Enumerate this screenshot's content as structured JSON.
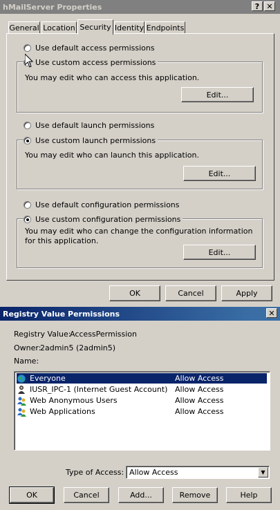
{
  "props_window": {
    "title": "hMailServer Properties",
    "help_glyph": "?",
    "close_glyph": "✕",
    "tabs": [
      "General",
      "Location",
      "Security",
      "Identity",
      "Endpoints"
    ],
    "selected_tab": "Security",
    "access": {
      "default_label": "Use default access permissions",
      "custom_label": "Use custom access permissions",
      "desc": "You may edit who can access this application.",
      "edit_label": "Edit..."
    },
    "launch": {
      "default_label": "Use default launch permissions",
      "custom_label": "Use custom launch permissions",
      "desc": "You may edit who can launch this application.",
      "edit_label": "Edit..."
    },
    "config": {
      "default_label": "Use default configuration permissions",
      "custom_label": "Use custom configuration permissions",
      "desc": "You may edit who can change the configuration information for this application.",
      "edit_label": "Edit..."
    },
    "buttons": {
      "ok": "OK",
      "cancel": "Cancel",
      "apply": "Apply"
    }
  },
  "reg_window": {
    "title": "Registry Value Permissions",
    "close_glyph": "✕",
    "registry_value_label": "Registry Value:",
    "registry_value": "AccessPermission",
    "owner_label": "Owner:",
    "owner": "2admin5 (2admin5)",
    "name_label": "Name:",
    "entries": [
      {
        "name": "Everyone",
        "access": "Allow Access",
        "icon": "globe-icon",
        "selected": true
      },
      {
        "name": "IUSR_IPC-1 (Internet Guest Account)",
        "access": "Allow Access",
        "icon": "user-icon",
        "selected": false
      },
      {
        "name": "Web Anonymous Users",
        "access": "Allow Access",
        "icon": "group-icon",
        "selected": false
      },
      {
        "name": "Web Applications",
        "access": "Allow Access",
        "icon": "group-icon",
        "selected": false
      }
    ],
    "type_of_access_label": "Type of Access:",
    "type_of_access_value": "Allow Access",
    "buttons": {
      "ok": "OK",
      "cancel": "Cancel",
      "add": "Add...",
      "remove": "Remove",
      "help": "Help"
    }
  },
  "colors": {
    "face": "#d4d0c8",
    "title_active": "#0a246a",
    "title_inactive": "#808080",
    "selection": "#0a246a"
  }
}
